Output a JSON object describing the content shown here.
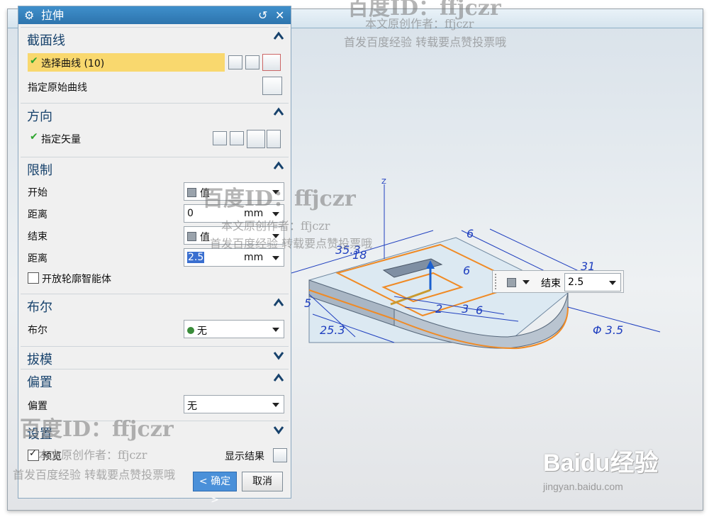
{
  "dialog": {
    "title": "拉伸",
    "reset_icon": "↺",
    "close_icon": "✕",
    "sections": {
      "section_curve": {
        "title": "截面线",
        "select_curve": "选择曲线 (10)",
        "specify_original": "指定原始曲线"
      },
      "direction": {
        "title": "方向",
        "specify_vector": "指定矢量"
      },
      "limits": {
        "title": "限制",
        "start_label": "开始",
        "start_value": "值",
        "start_distance_label": "距离",
        "start_distance": "0",
        "start_unit": "mm",
        "end_label": "结束",
        "end_value": "值",
        "end_distance_label": "距离",
        "end_distance": "2.5",
        "end_unit": "mm",
        "open_profile": "开放轮廓智能体"
      },
      "boolean": {
        "title": "布尔",
        "label": "布尔",
        "value": "无"
      },
      "draft": {
        "title": "拔模"
      },
      "offset": {
        "title": "偏置",
        "label": "偏置",
        "value": "无"
      },
      "settings": {
        "title": "设置"
      }
    },
    "preview_label": "预览",
    "show_result": "显示结果",
    "ok_button": "< 确定 >",
    "cancel_button": "取消"
  },
  "float_toolbar": {
    "end_label": "结束",
    "end_value": "2.5"
  },
  "dimensions": [
    "6",
    "31",
    "35.3",
    "18",
    "6",
    "3",
    "2",
    "6",
    "5",
    "25.3",
    "Φ 3.5"
  ],
  "axis_label": "Z",
  "watermarks": {
    "id_text": "百度ID：ffjczr",
    "author": "本文原创作者：ffjczr",
    "slogan": "首发百度经验 转载要点赞投票哦",
    "brand": "Baidu经验",
    "url": "jingyan.baidu.com"
  },
  "colors": {
    "title_bar": "#3076b1",
    "selection_highlight": "#f9d86e",
    "section_title": "#17426c",
    "dimension_blue": "#1f3fbf",
    "profile_orange": "#f08a24"
  }
}
